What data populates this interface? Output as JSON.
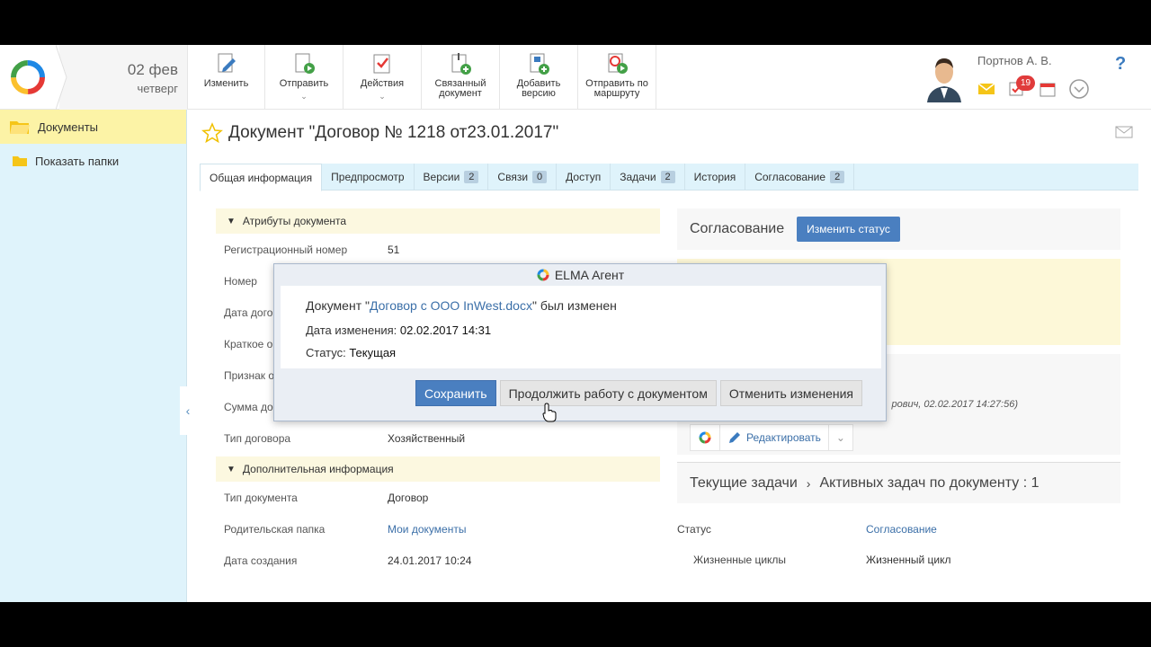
{
  "header": {
    "date": "02 фев",
    "weekday": "четверг",
    "user_name": "Портнов А. В.",
    "notifications_count": "19",
    "help": "?"
  },
  "toolbar": [
    {
      "label": "Изменить",
      "icon": "edit-doc-icon",
      "dropdown": false
    },
    {
      "label": "Отправить",
      "icon": "send-doc-icon",
      "dropdown": true
    },
    {
      "label": "Действия",
      "icon": "actions-icon",
      "dropdown": true
    },
    {
      "label": "Связанный документ",
      "icon": "linked-doc-icon",
      "dropdown": false
    },
    {
      "label": "Добавить версию",
      "icon": "add-version-icon",
      "dropdown": false
    },
    {
      "label": "Отправить по маршруту",
      "icon": "route-icon",
      "dropdown": false
    }
  ],
  "sidebar": {
    "items": [
      {
        "label": "Документы",
        "icon": "folder-open-icon",
        "active": true
      },
      {
        "label": "Показать папки",
        "icon": "folder-icon",
        "active": false
      }
    ]
  },
  "document": {
    "title": "Документ \"Договор № 1218 от23.01.2017\""
  },
  "tabs": [
    {
      "label": "Общая информация",
      "count": ""
    },
    {
      "label": "Предпросмотр",
      "count": ""
    },
    {
      "label": "Версии",
      "count": "2"
    },
    {
      "label": "Связи",
      "count": "0"
    },
    {
      "label": "Доступ",
      "count": ""
    },
    {
      "label": "Задачи",
      "count": "2"
    },
    {
      "label": "История",
      "count": ""
    },
    {
      "label": "Согласование",
      "count": "2"
    }
  ],
  "attributes": {
    "section_title": "Атрибуты документа",
    "fields": [
      {
        "label": "Регистрационный номер",
        "value": "51"
      },
      {
        "label": "Номер",
        "value": ""
      },
      {
        "label": "Дата догов",
        "value": ""
      },
      {
        "label": "Краткое о",
        "value": ""
      },
      {
        "label": "Признак о",
        "value": ""
      },
      {
        "label": "Сумма дог",
        "value": ""
      },
      {
        "label": "Тип договора",
        "value": "Хозяйственный"
      }
    ]
  },
  "additional": {
    "section_title": "Дополнительная информация",
    "fields": [
      {
        "label": "Тип документа",
        "value": "Договор"
      },
      {
        "label": "Родительская папка",
        "value": "Мои документы"
      },
      {
        "label": "Дата создания",
        "value": "24.01.2017 10:24"
      }
    ]
  },
  "right": {
    "approval_title": "Согласование",
    "change_status": "Изменить статус",
    "timestamp_text": "рович, 02.02.2017 14:27:56)",
    "edit_label": "Редактировать",
    "tasks_title": "Текущие задачи",
    "tasks_active": "Активных задач по документу : 1",
    "status_label": "Статус",
    "status_value": "Согласование",
    "lifecycle_label": "Жизненные циклы",
    "lifecycle_value": "Жизненный цикл"
  },
  "modal": {
    "title": "ELMA Агент",
    "msg_prefix": "Документ \"",
    "msg_link": "Договор с ООО InWest.docx",
    "msg_suffix": "\" был изменен",
    "date_label": "Дата изменения:",
    "date_value": "02.02.2017 14:31",
    "status_label": "Статус:",
    "status_value": "Текущая",
    "btn_save": "Сохранить",
    "btn_continue": "Продолжить работу с документом",
    "btn_cancel": "Отменить изменения"
  },
  "colors": {
    "accent": "#4a7fc0",
    "sidebar_bg": "#dff3fb",
    "active_item": "#fcf3a6",
    "badge": "#e03b3b"
  }
}
